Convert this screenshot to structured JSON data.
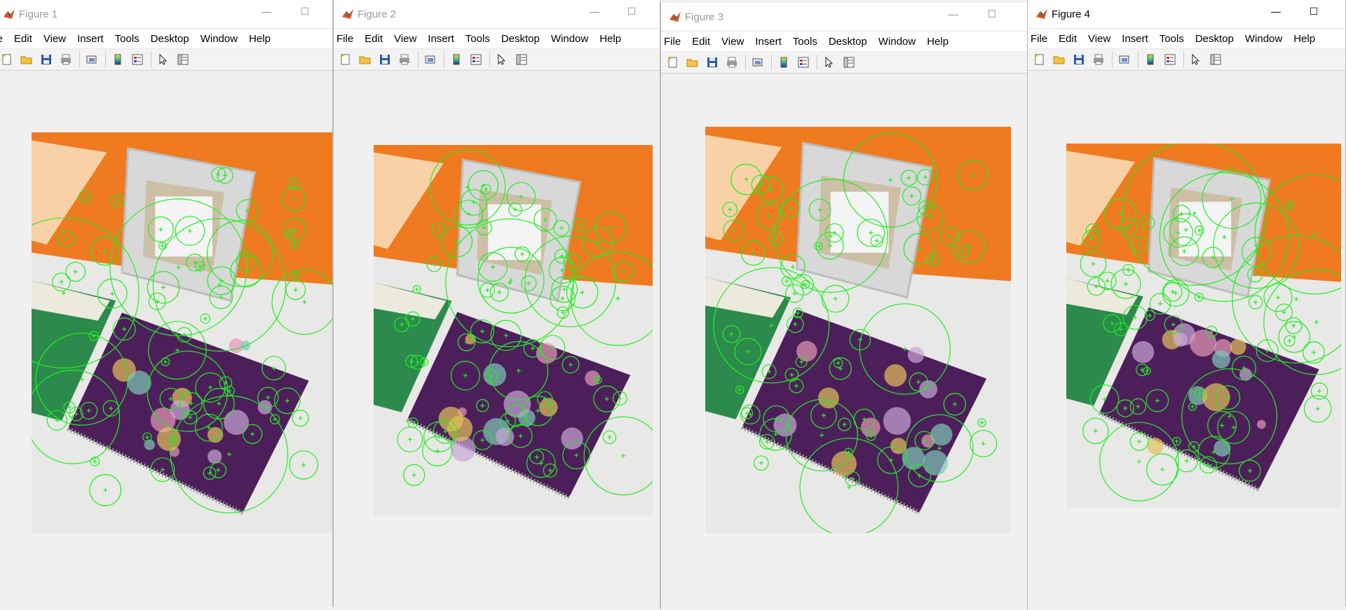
{
  "windows": [
    {
      "title": "Figure 1",
      "menu": [
        "File",
        "Edit",
        "View",
        "Insert",
        "Tools",
        "Desktop",
        "Window",
        "Help"
      ],
      "menu_visible_first": "ile",
      "minimize_icon": "minimize-icon",
      "maximize_icon": "maximize-icon"
    },
    {
      "title": "Figure 2",
      "menu": [
        "File",
        "Edit",
        "View",
        "Insert",
        "Tools",
        "Desktop",
        "Window",
        "Help"
      ]
    },
    {
      "title": "Figure 3",
      "menu": [
        "File",
        "Edit",
        "View",
        "Insert",
        "Tools",
        "Desktop",
        "Window",
        "Help"
      ]
    },
    {
      "title": "Figure 4",
      "menu": [
        "File",
        "Edit",
        "View",
        "Insert",
        "Tools",
        "Desktop",
        "Window",
        "Help"
      ]
    }
  ],
  "toolbar_icons": [
    "new-figure-icon",
    "open-file-icon",
    "save-icon",
    "print-icon",
    "link-plot-icon",
    "insert-colorbar-icon",
    "insert-legend-icon",
    "edit-plot-icon",
    "property-inspector-icon"
  ],
  "colors": {
    "feature_marker": "#22ee22",
    "background_wall": "#f07a1f",
    "table": "#e8e8e6",
    "notebook": "#4d1f5a",
    "frame": "#d8d8d8"
  }
}
